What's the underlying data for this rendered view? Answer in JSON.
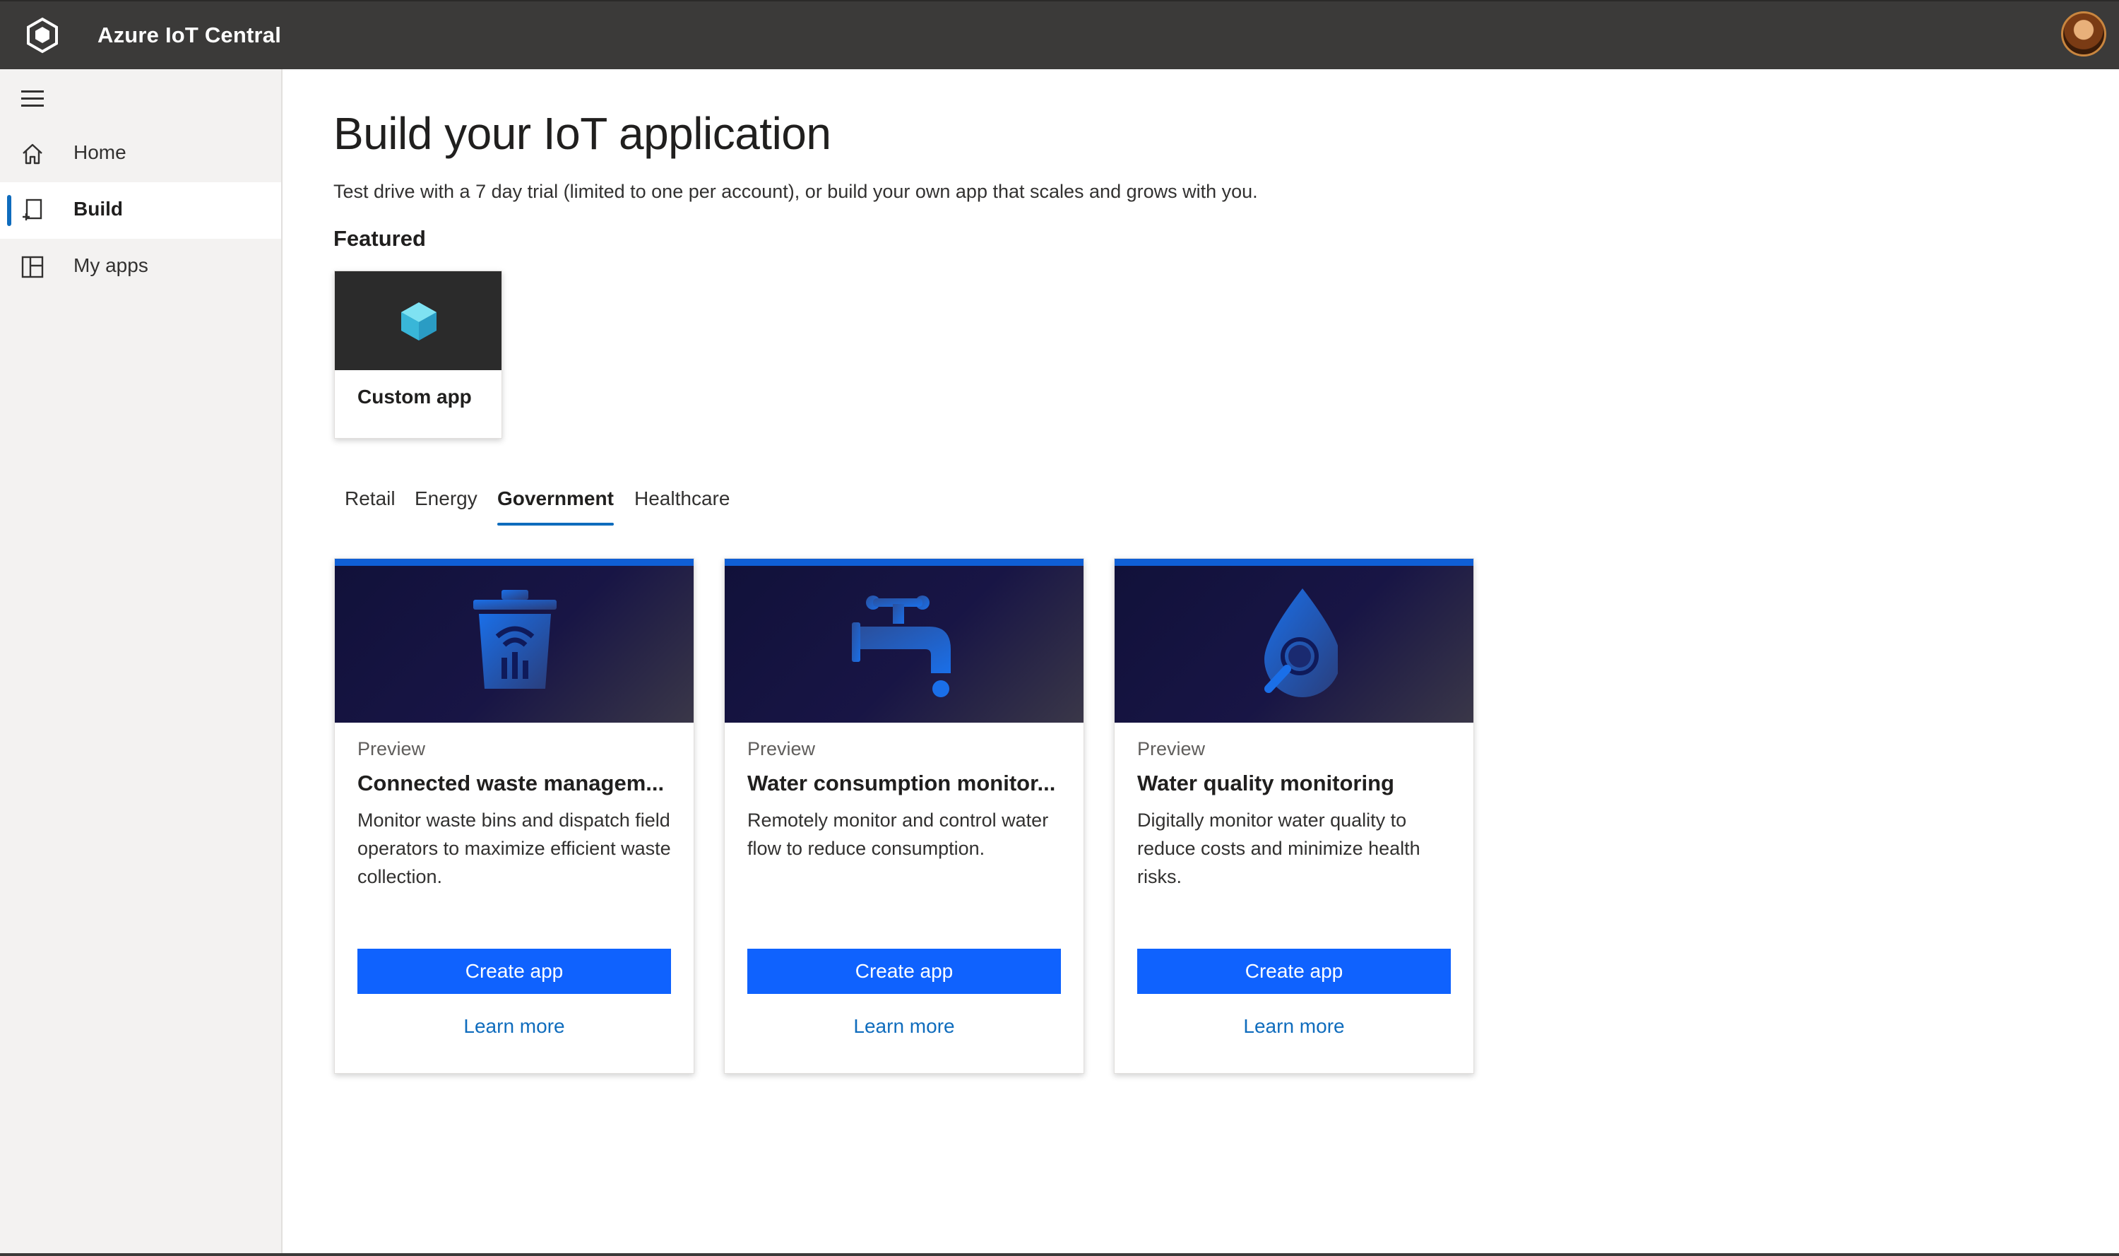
{
  "header": {
    "app_title": "Azure IoT Central",
    "logo_icon": "iot-central-hexagon-icon",
    "avatar_icon": "user-avatar"
  },
  "sidebar": {
    "menu_icon": "hamburger-menu-icon",
    "items": [
      {
        "label": "Home",
        "icon": "home-icon",
        "active": false
      },
      {
        "label": "Build",
        "icon": "build-icon",
        "active": true
      },
      {
        "label": "My apps",
        "icon": "apps-grid-icon",
        "active": false
      }
    ]
  },
  "main": {
    "title": "Build your IoT application",
    "subtitle": "Test drive with a 7 day trial (limited to one per account), or build your own app that scales and grows with you.",
    "featured_label": "Featured",
    "featured_card": {
      "label": "Custom app",
      "icon": "cube-icon"
    },
    "tabs": [
      {
        "label": "Retail",
        "active": false
      },
      {
        "label": "Energy",
        "active": false
      },
      {
        "label": "Government",
        "active": true
      },
      {
        "label": "Healthcare",
        "active": false
      }
    ],
    "cards": [
      {
        "badge": "Preview",
        "title": "Connected waste managem...",
        "description": "Monitor waste bins and dispatch field operators to maximize efficient waste collection.",
        "create_label": "Create app",
        "learn_label": "Learn more",
        "icon": "trash-bin-icon"
      },
      {
        "badge": "Preview",
        "title": "Water consumption monitor...",
        "description": "Remotely monitor and control water flow to reduce consumption.",
        "create_label": "Create app",
        "learn_label": "Learn more",
        "icon": "water-faucet-icon"
      },
      {
        "badge": "Preview",
        "title": "Water quality monitoring",
        "description": "Digitally monitor water quality to reduce costs and minimize health risks.",
        "create_label": "Create app",
        "learn_label": "Learn more",
        "icon": "water-drop-magnifier-icon"
      }
    ]
  },
  "colors": {
    "header_bg": "#3b3a39",
    "accent": "#0f62fe",
    "link": "#0f6cbd",
    "banner_top": "#0f5fd6"
  }
}
